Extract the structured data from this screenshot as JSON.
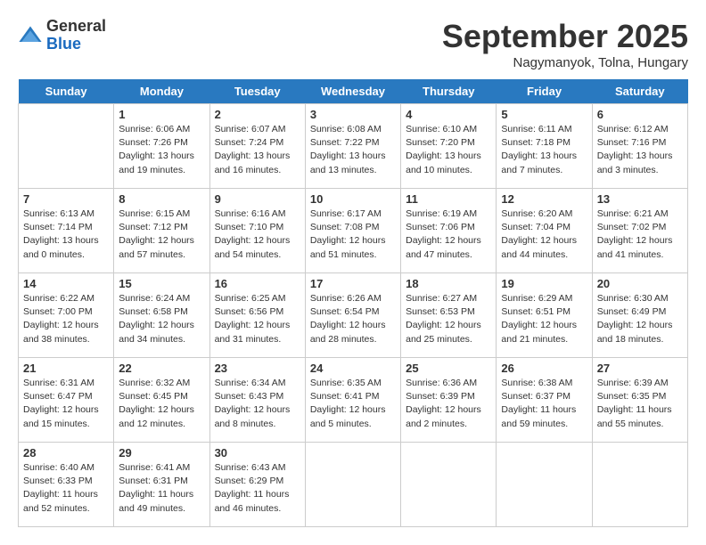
{
  "logo": {
    "general": "General",
    "blue": "Blue"
  },
  "title": "September 2025",
  "location": "Nagymanyok, Tolna, Hungary",
  "days": [
    "Sunday",
    "Monday",
    "Tuesday",
    "Wednesday",
    "Thursday",
    "Friday",
    "Saturday"
  ],
  "weeks": [
    [
      {
        "date": "",
        "sunrise": "",
        "sunset": "",
        "daylight": ""
      },
      {
        "date": "1",
        "sunrise": "Sunrise: 6:06 AM",
        "sunset": "Sunset: 7:26 PM",
        "daylight": "Daylight: 13 hours and 19 minutes."
      },
      {
        "date": "2",
        "sunrise": "Sunrise: 6:07 AM",
        "sunset": "Sunset: 7:24 PM",
        "daylight": "Daylight: 13 hours and 16 minutes."
      },
      {
        "date": "3",
        "sunrise": "Sunrise: 6:08 AM",
        "sunset": "Sunset: 7:22 PM",
        "daylight": "Daylight: 13 hours and 13 minutes."
      },
      {
        "date": "4",
        "sunrise": "Sunrise: 6:10 AM",
        "sunset": "Sunset: 7:20 PM",
        "daylight": "Daylight: 13 hours and 10 minutes."
      },
      {
        "date": "5",
        "sunrise": "Sunrise: 6:11 AM",
        "sunset": "Sunset: 7:18 PM",
        "daylight": "Daylight: 13 hours and 7 minutes."
      },
      {
        "date": "6",
        "sunrise": "Sunrise: 6:12 AM",
        "sunset": "Sunset: 7:16 PM",
        "daylight": "Daylight: 13 hours and 3 minutes."
      }
    ],
    [
      {
        "date": "7",
        "sunrise": "Sunrise: 6:13 AM",
        "sunset": "Sunset: 7:14 PM",
        "daylight": "Daylight: 13 hours and 0 minutes."
      },
      {
        "date": "8",
        "sunrise": "Sunrise: 6:15 AM",
        "sunset": "Sunset: 7:12 PM",
        "daylight": "Daylight: 12 hours and 57 minutes."
      },
      {
        "date": "9",
        "sunrise": "Sunrise: 6:16 AM",
        "sunset": "Sunset: 7:10 PM",
        "daylight": "Daylight: 12 hours and 54 minutes."
      },
      {
        "date": "10",
        "sunrise": "Sunrise: 6:17 AM",
        "sunset": "Sunset: 7:08 PM",
        "daylight": "Daylight: 12 hours and 51 minutes."
      },
      {
        "date": "11",
        "sunrise": "Sunrise: 6:19 AM",
        "sunset": "Sunset: 7:06 PM",
        "daylight": "Daylight: 12 hours and 47 minutes."
      },
      {
        "date": "12",
        "sunrise": "Sunrise: 6:20 AM",
        "sunset": "Sunset: 7:04 PM",
        "daylight": "Daylight: 12 hours and 44 minutes."
      },
      {
        "date": "13",
        "sunrise": "Sunrise: 6:21 AM",
        "sunset": "Sunset: 7:02 PM",
        "daylight": "Daylight: 12 hours and 41 minutes."
      }
    ],
    [
      {
        "date": "14",
        "sunrise": "Sunrise: 6:22 AM",
        "sunset": "Sunset: 7:00 PM",
        "daylight": "Daylight: 12 hours and 38 minutes."
      },
      {
        "date": "15",
        "sunrise": "Sunrise: 6:24 AM",
        "sunset": "Sunset: 6:58 PM",
        "daylight": "Daylight: 12 hours and 34 minutes."
      },
      {
        "date": "16",
        "sunrise": "Sunrise: 6:25 AM",
        "sunset": "Sunset: 6:56 PM",
        "daylight": "Daylight: 12 hours and 31 minutes."
      },
      {
        "date": "17",
        "sunrise": "Sunrise: 6:26 AM",
        "sunset": "Sunset: 6:54 PM",
        "daylight": "Daylight: 12 hours and 28 minutes."
      },
      {
        "date": "18",
        "sunrise": "Sunrise: 6:27 AM",
        "sunset": "Sunset: 6:53 PM",
        "daylight": "Daylight: 12 hours and 25 minutes."
      },
      {
        "date": "19",
        "sunrise": "Sunrise: 6:29 AM",
        "sunset": "Sunset: 6:51 PM",
        "daylight": "Daylight: 12 hours and 21 minutes."
      },
      {
        "date": "20",
        "sunrise": "Sunrise: 6:30 AM",
        "sunset": "Sunset: 6:49 PM",
        "daylight": "Daylight: 12 hours and 18 minutes."
      }
    ],
    [
      {
        "date": "21",
        "sunrise": "Sunrise: 6:31 AM",
        "sunset": "Sunset: 6:47 PM",
        "daylight": "Daylight: 12 hours and 15 minutes."
      },
      {
        "date": "22",
        "sunrise": "Sunrise: 6:32 AM",
        "sunset": "Sunset: 6:45 PM",
        "daylight": "Daylight: 12 hours and 12 minutes."
      },
      {
        "date": "23",
        "sunrise": "Sunrise: 6:34 AM",
        "sunset": "Sunset: 6:43 PM",
        "daylight": "Daylight: 12 hours and 8 minutes."
      },
      {
        "date": "24",
        "sunrise": "Sunrise: 6:35 AM",
        "sunset": "Sunset: 6:41 PM",
        "daylight": "Daylight: 12 hours and 5 minutes."
      },
      {
        "date": "25",
        "sunrise": "Sunrise: 6:36 AM",
        "sunset": "Sunset: 6:39 PM",
        "daylight": "Daylight: 12 hours and 2 minutes."
      },
      {
        "date": "26",
        "sunrise": "Sunrise: 6:38 AM",
        "sunset": "Sunset: 6:37 PM",
        "daylight": "Daylight: 11 hours and 59 minutes."
      },
      {
        "date": "27",
        "sunrise": "Sunrise: 6:39 AM",
        "sunset": "Sunset: 6:35 PM",
        "daylight": "Daylight: 11 hours and 55 minutes."
      }
    ],
    [
      {
        "date": "28",
        "sunrise": "Sunrise: 6:40 AM",
        "sunset": "Sunset: 6:33 PM",
        "daylight": "Daylight: 11 hours and 52 minutes."
      },
      {
        "date": "29",
        "sunrise": "Sunrise: 6:41 AM",
        "sunset": "Sunset: 6:31 PM",
        "daylight": "Daylight: 11 hours and 49 minutes."
      },
      {
        "date": "30",
        "sunrise": "Sunrise: 6:43 AM",
        "sunset": "Sunset: 6:29 PM",
        "daylight": "Daylight: 11 hours and 46 minutes."
      },
      {
        "date": "",
        "sunrise": "",
        "sunset": "",
        "daylight": ""
      },
      {
        "date": "",
        "sunrise": "",
        "sunset": "",
        "daylight": ""
      },
      {
        "date": "",
        "sunrise": "",
        "sunset": "",
        "daylight": ""
      },
      {
        "date": "",
        "sunrise": "",
        "sunset": "",
        "daylight": ""
      }
    ]
  ]
}
